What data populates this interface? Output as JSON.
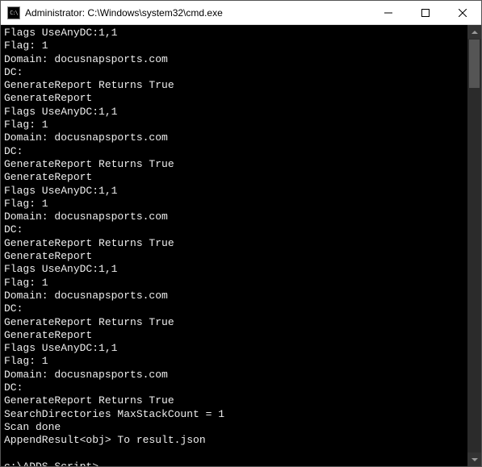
{
  "window": {
    "title": "Administrator: C:\\Windows\\system32\\cmd.exe",
    "icon_label": "C:\\"
  },
  "terminal": {
    "lines": [
      "Flags UseAnyDC:1,1",
      "Flag: 1",
      "Domain: docusnapsports.com",
      "DC:",
      "GenerateReport Returns True",
      "GenerateReport",
      "Flags UseAnyDC:1,1",
      "Flag: 1",
      "Domain: docusnapsports.com",
      "DC:",
      "GenerateReport Returns True",
      "GenerateReport",
      "Flags UseAnyDC:1,1",
      "Flag: 1",
      "Domain: docusnapsports.com",
      "DC:",
      "GenerateReport Returns True",
      "GenerateReport",
      "Flags UseAnyDC:1,1",
      "Flag: 1",
      "Domain: docusnapsports.com",
      "DC:",
      "GenerateReport Returns True",
      "GenerateReport",
      "Flags UseAnyDC:1,1",
      "Flag: 1",
      "Domain: docusnapsports.com",
      "DC:",
      "GenerateReport Returns True",
      "SearchDirectories MaxStackCount = 1",
      "Scan done",
      "AppendResult<obj> To result.json",
      ""
    ],
    "prompt": "c:\\ADDS_Script>"
  }
}
